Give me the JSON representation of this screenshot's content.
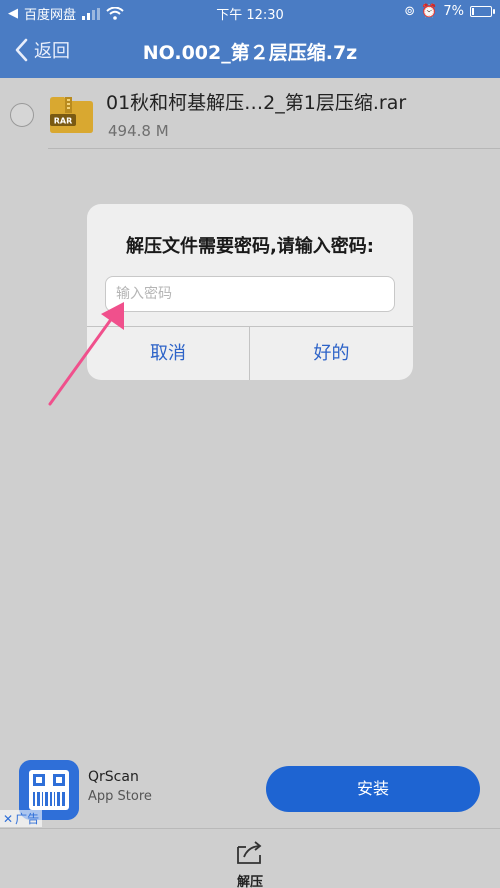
{
  "status_bar": {
    "carrier": "百度网盘",
    "time": "下午 12:30",
    "battery_percent": "7%",
    "battery_level": 0.07
  },
  "nav": {
    "back_label": "返回",
    "title": "NO.002_第２层压缩.7z"
  },
  "file": {
    "icon_label": "RAR",
    "name": "01秋和柯基解压…2_第1层压缩.rar",
    "size": "494.8 M"
  },
  "dialog": {
    "title": "解压文件需要密码,请输入密码:",
    "input_placeholder": "输入密码",
    "input_value": "",
    "cancel_label": "取消",
    "ok_label": "好的"
  },
  "ad": {
    "app_name": "QrScan",
    "store": "App Store",
    "ad_tag": "广告",
    "install_label": "安装"
  },
  "toolbar": {
    "extract_label": "解压"
  },
  "colors": {
    "nav_blue": "#4a7cc4",
    "dialog_button_blue": "#2d63c8",
    "install_blue": "#1e64d2",
    "arrow_pink": "#f0508c",
    "rar_folder_yellow": "#d9a830"
  },
  "icons": {
    "back": "chevron-left-icon",
    "file": "rar-archive-icon",
    "extract": "extract-icon",
    "ad_app": "qr-code-icon",
    "ad_close": "close-icon"
  }
}
